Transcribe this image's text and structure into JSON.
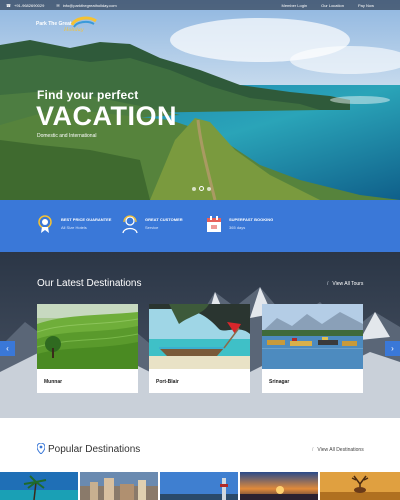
{
  "topbar": {
    "phone": "+91-9682690029",
    "email": "info@parkthegreatholiday.com",
    "links": [
      "Member Login",
      "Our Location",
      "Pay Now"
    ]
  },
  "brand": {
    "name": "Park The Great",
    "script": "Holiday"
  },
  "hero": {
    "subtitle": "Find your perfect",
    "title": "VACATION",
    "tagline": "Domestic and International"
  },
  "features": [
    {
      "icon": "badge-icon",
      "title": "BEST PRICE GUARANTEE",
      "subtitle": "All Size Hotels"
    },
    {
      "icon": "support-icon",
      "title": "GREAT CUSTOMER",
      "subtitle": "Service"
    },
    {
      "icon": "calendar-icon",
      "title": "SUPERFAST BOOKING",
      "subtitle": "365 days"
    }
  ],
  "latest": {
    "title": "Our Latest Destinations",
    "view_all": "View All Tours",
    "cards": [
      {
        "name": "Munnar"
      },
      {
        "name": "Port-Blair"
      },
      {
        "name": "Srinagar"
      }
    ]
  },
  "popular": {
    "title": "Popular Destinations",
    "view_all": "View All Destinations"
  },
  "colors": {
    "accent": "#3a78d8",
    "logo_script": "#f6c232"
  }
}
